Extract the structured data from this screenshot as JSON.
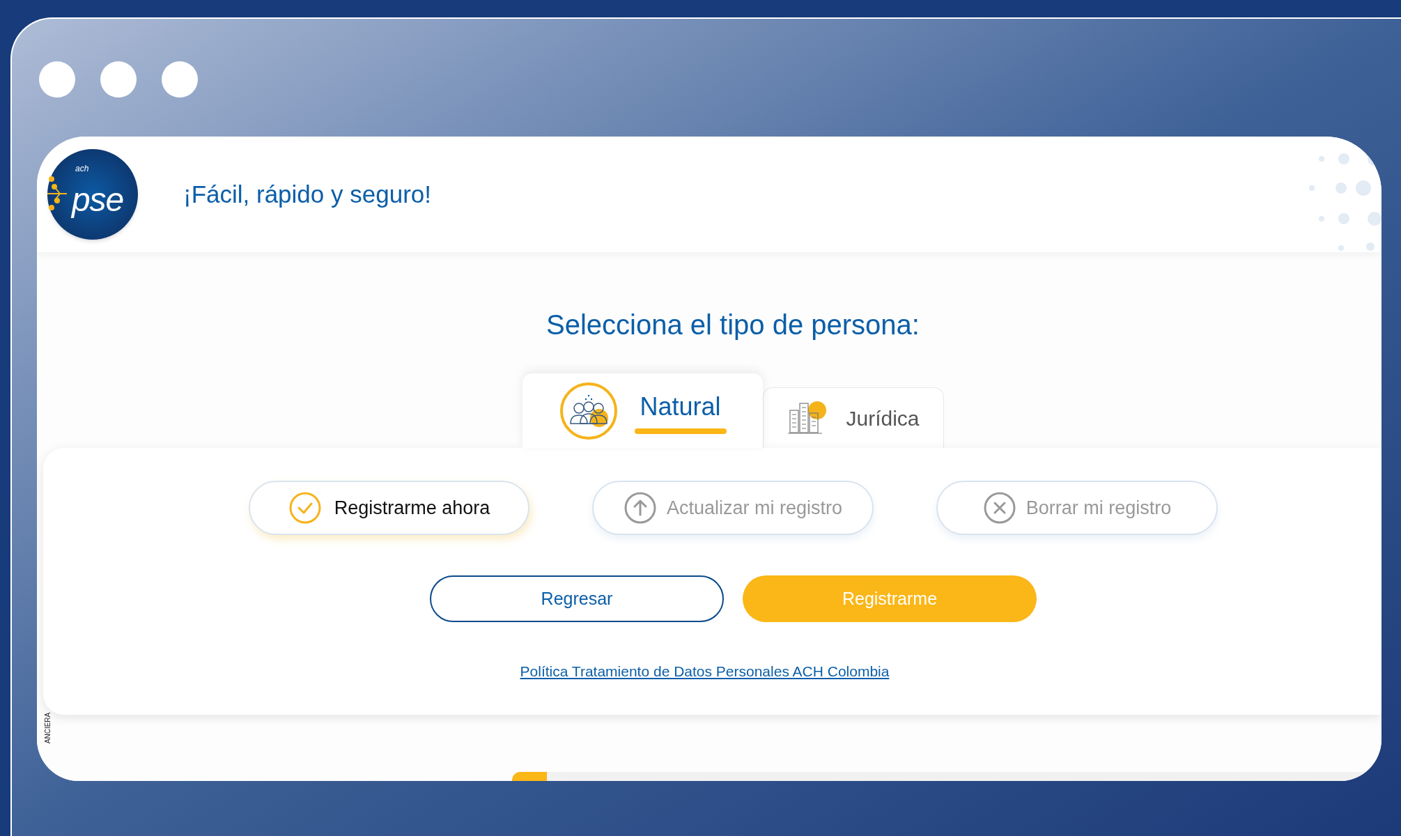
{
  "header": {
    "logo_subtext": "ach",
    "logo_text": "pse",
    "tagline": "¡Fácil, rápido y seguro!"
  },
  "heading": "Selecciona el tipo de persona:",
  "tabs": [
    {
      "label": "Natural",
      "selected": true,
      "kind": "people"
    },
    {
      "label": "Jurídica",
      "selected": false,
      "kind": "buildings"
    }
  ],
  "options": [
    {
      "label": "Registrarme ahora",
      "selected": true,
      "kind": "check"
    },
    {
      "label": "Actualizar mi registro",
      "selected": false,
      "kind": "update"
    },
    {
      "label": "Borrar mi registro",
      "selected": false,
      "kind": "delete"
    }
  ],
  "buttons": [
    {
      "label": "Regresar",
      "kind": "secondary"
    },
    {
      "label": "Registrarme",
      "kind": "primary"
    }
  ],
  "link": "Política Tratamiento de Datos Personales ACH Colombia",
  "side_text": "ANCIERA",
  "progress": {
    "level": 0.04
  }
}
